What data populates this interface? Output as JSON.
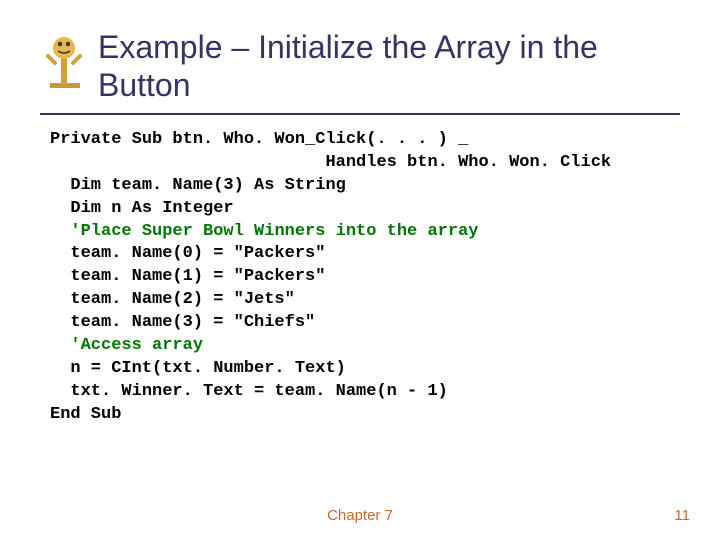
{
  "title": "Example – Initialize the Array in the Button",
  "code": {
    "l1": "Private Sub btn. Who. Won_Click(. . . ) _",
    "l2": "                           Handles btn. Who. Won. Click",
    "l3": "  Dim team. Name(3) As String",
    "l4": "  Dim n As Integer",
    "l5a": "  ",
    "l5b": "'Place Super Bowl Winners into the array",
    "l6": "  team. Name(0) = \"Packers\"",
    "l7": "  team. Name(1) = \"Packers\"",
    "l8": "  team. Name(2) = \"Jets\"",
    "l9": "  team. Name(3) = \"Chiefs\"",
    "l10a": "  ",
    "l10b": "'Access array",
    "l11": "  n = CInt(txt. Number. Text)",
    "l12": "  txt. Winner. Text = team. Name(n - 1)",
    "l13": "End Sub"
  },
  "footer": {
    "chapter": "Chapter 7",
    "page": "11"
  }
}
